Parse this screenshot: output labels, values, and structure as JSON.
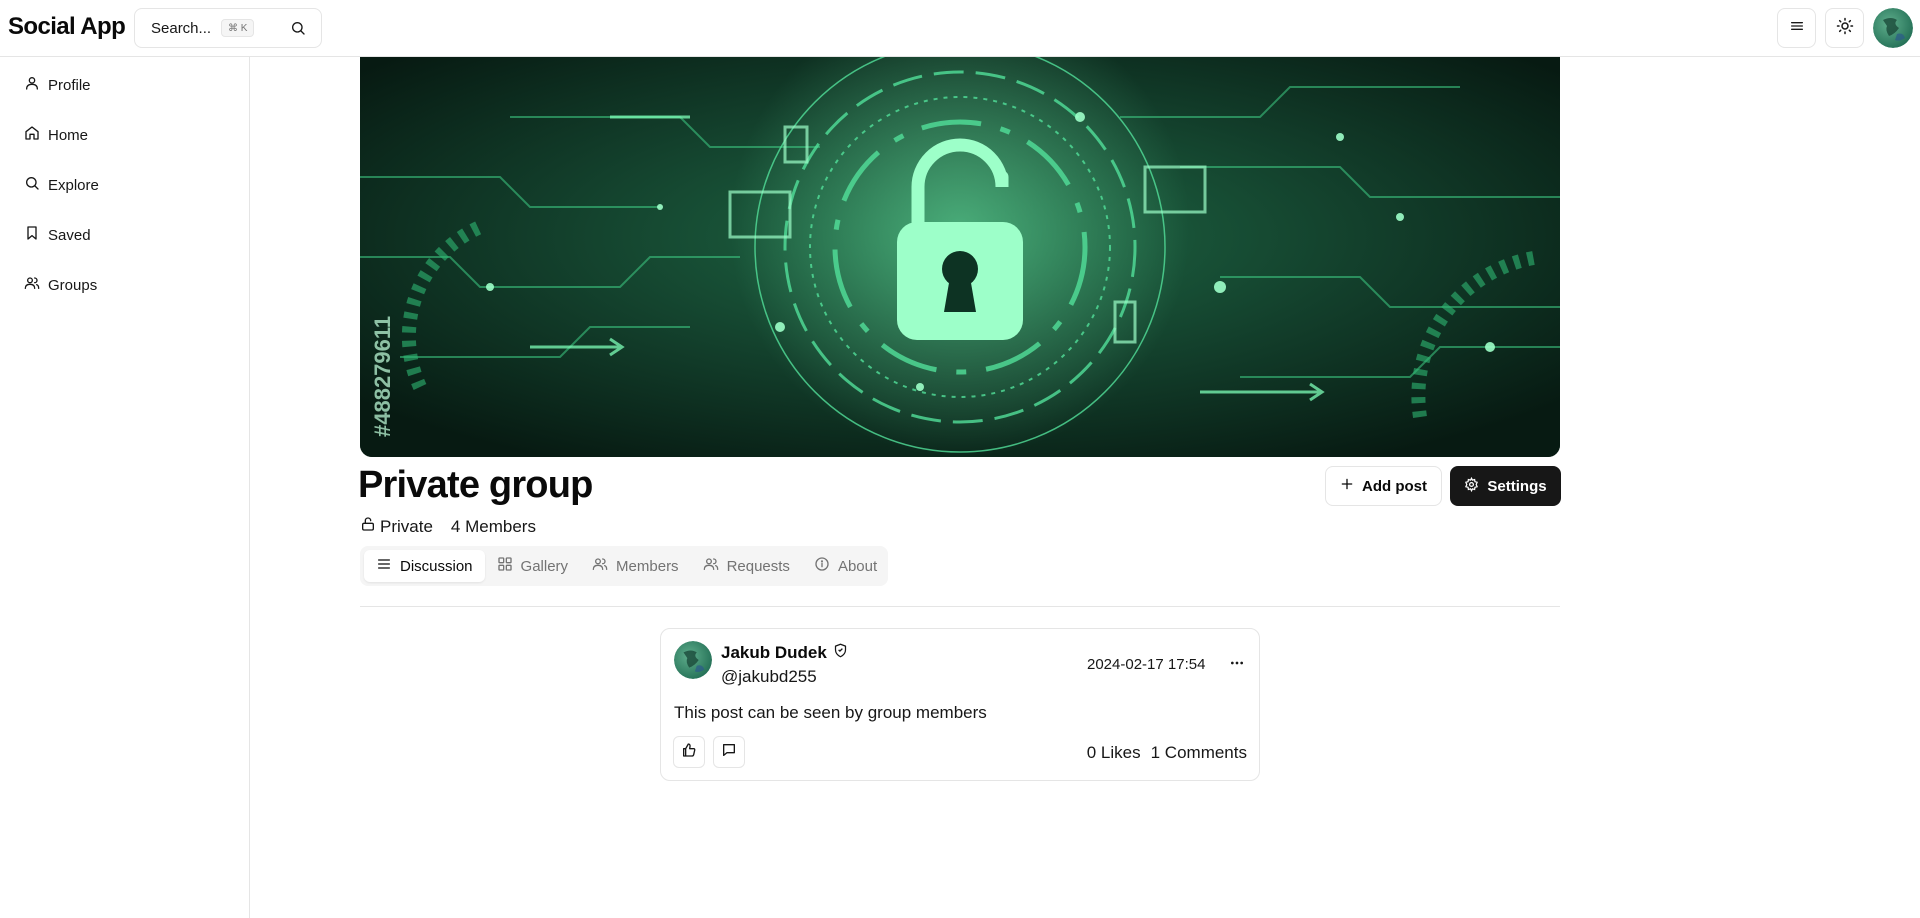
{
  "app": {
    "title": "Social App"
  },
  "search": {
    "placeholder": "Search...",
    "shortcut": "⌘ K"
  },
  "header": {
    "menu_icon": "menu-icon",
    "theme_icon": "sun-icon"
  },
  "sidebar": {
    "items": [
      {
        "label": "Profile",
        "icon": "user-icon"
      },
      {
        "label": "Home",
        "icon": "home-icon"
      },
      {
        "label": "Explore",
        "icon": "search-icon"
      },
      {
        "label": "Saved",
        "icon": "bookmark-icon"
      },
      {
        "label": "Groups",
        "icon": "users-icon"
      }
    ]
  },
  "group": {
    "name": "Private group",
    "privacy": "Private",
    "members": "4 Members",
    "cover_watermark": "#488279611",
    "add_post_label": "Add post",
    "settings_label": "Settings"
  },
  "tabs": [
    {
      "label": "Discussion",
      "active": true
    },
    {
      "label": "Gallery",
      "active": false
    },
    {
      "label": "Members",
      "active": false
    },
    {
      "label": "Requests",
      "active": false
    },
    {
      "label": "About",
      "active": false
    }
  ],
  "post": {
    "author": "Jakub Dudek",
    "handle": "@jakubd255",
    "date": "2024-02-17 17:54",
    "text": "This post can be seen by group members",
    "likes": "0 Likes",
    "comments": "1 Comments"
  },
  "colors": {
    "accent": "#171717",
    "border": "#e5e5e5",
    "muted": "#737373",
    "cover_green": "#4ade80"
  }
}
